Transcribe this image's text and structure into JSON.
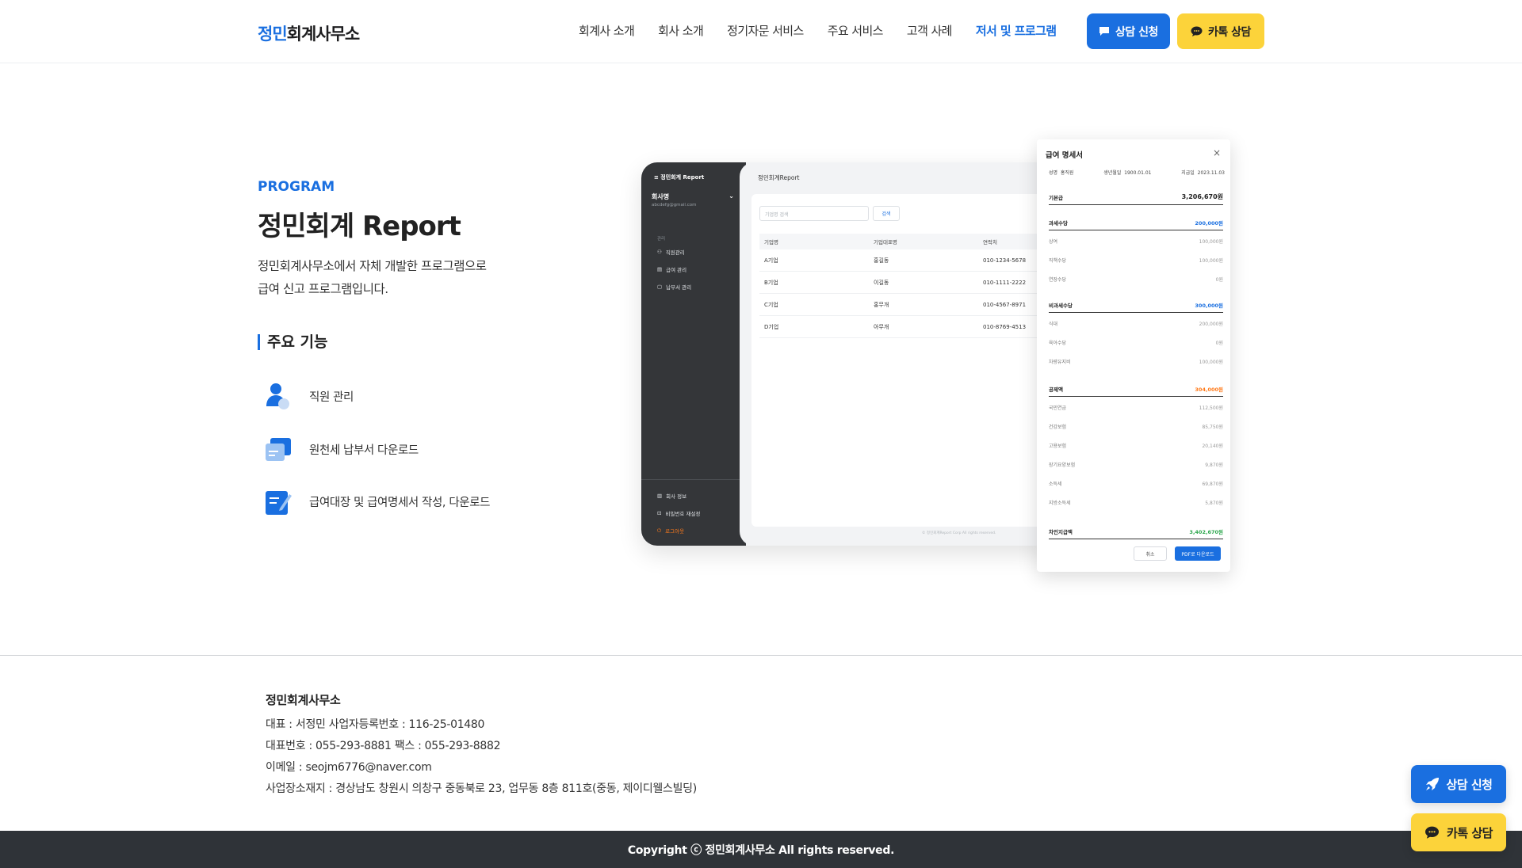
{
  "header": {
    "logo_accent": "정민",
    "logo_rest": "회계사무소",
    "nav": [
      "회계사 소개",
      "회사 소개",
      "정기자문 서비스",
      "주요 서비스",
      "고객 사례",
      "저서 및 프로그램"
    ],
    "consult_btn": "상담 신청",
    "kakao_btn": "카톡 상담"
  },
  "intro": {
    "eyebrow": "PROGRAM",
    "title": "정민회계 Report",
    "desc_line1": "정민회계사무소에서 자체 개발한 프로그램으로",
    "desc_line2": "급여 신고 프로그램입니다.",
    "features_title": "주요 기능",
    "features": [
      "직원 관리",
      "원천세 납부서 다운로드",
      "급여대장 및 급여명세서 작성, 다운로드"
    ]
  },
  "mock": {
    "brand": "≡ 정민회계 Report",
    "company": "회사명",
    "email": "abcdefg@gmail.com",
    "section": "관리",
    "menu": [
      "직원관리",
      "급여 관리",
      "납부서 관리"
    ],
    "bottom_menu": [
      "회사 정보",
      "비밀번호 재설정",
      "로그아웃"
    ],
    "main_title": "정민회계Report",
    "search_placeholder": "기업명 검색",
    "search_btn": "검색",
    "columns": [
      "기업명",
      "기업대표명",
      "연락처"
    ],
    "rows": [
      [
        "A기업",
        "홍길동",
        "010-1234-5678"
      ],
      [
        "B기업",
        "이길동",
        "010-1111-2222"
      ],
      [
        "C기업",
        "홍무개",
        "010-4567-8971"
      ],
      [
        "D기업",
        "아무개",
        "010-8769-4513"
      ]
    ],
    "copyright": "© 정민회계Report Corp All rights reserved."
  },
  "payslip": {
    "title": "급여 명세서",
    "close": "×",
    "name_label": "성명",
    "name": "홍직원",
    "birth_label": "생년월일",
    "birth": "1900.01.01",
    "pay_label": "지급일",
    "pay_date": "2023.11.03",
    "base_label": "기본급",
    "base_value": "3,206,670원",
    "taxable": {
      "label": "과세수당",
      "total": "200,000원",
      "items": [
        [
          "상여",
          "100,000원"
        ],
        [
          "직책수당",
          "100,000원"
        ],
        [
          "연장수당",
          "0원"
        ]
      ]
    },
    "nontaxable": {
      "label": "비과세수당",
      "total": "300,000원",
      "items": [
        [
          "식대",
          "200,000원"
        ],
        [
          "육아수당",
          "0원"
        ],
        [
          "차량유지비",
          "100,000원"
        ]
      ]
    },
    "deduction": {
      "label": "공제액",
      "total": "304,000원",
      "items": [
        [
          "국민연금",
          "112,500원"
        ],
        [
          "건강보험",
          "85,750원"
        ],
        [
          "고용보험",
          "20,140원"
        ],
        [
          "장기요양보험",
          "9,870원"
        ],
        [
          "소득세",
          "69,870원"
        ],
        [
          "지방소득세",
          "5,870원"
        ]
      ]
    },
    "net_label": "차인지급액",
    "net_value": "3,402,670원",
    "cancel_btn": "취소",
    "pdf_btn": "PDF로 다운로드"
  },
  "footer": {
    "name": "정민회계사무소",
    "line1": "대표 : 서정민  사업자등록번호 : 116-25-01480",
    "line2": "대표번호 : 055-293-8881   팩스 : 055-293-8882",
    "line3": "이메일 : seojm6776@naver.com",
    "line4": "사업장소재지 : 경상남도 창원시 의창구 중동북로 23, 업무동 8층 811호(중동, 제이디웰스빌딩)",
    "copyright": "Copyright ⓒ 정민회계사무소 All rights reserved."
  },
  "floating": {
    "consult": "상담 신청",
    "kakao": "카톡 상담"
  },
  "colors": {
    "accent": "#1a6fe0",
    "kakao": "#fcd33a",
    "deduction": "#ff7a1a",
    "net": "#2fa84f",
    "sidebar": "#343639",
    "footer_bar": "#2f3338"
  }
}
